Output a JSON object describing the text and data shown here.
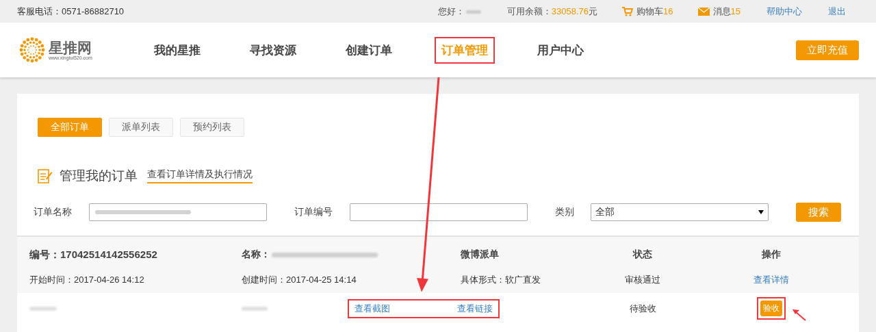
{
  "top_bar": {
    "hotline": "客服电话：0571-86882710",
    "greeting": "您好：",
    "balance_label": "可用余额：",
    "balance": "33058.76",
    "balance_unit": "元",
    "cart_label": "购物车",
    "cart_count": "16",
    "messages_label": "消息",
    "messages_count": "15",
    "links": [
      "帮助中心",
      "退出"
    ]
  },
  "logo": {
    "name": "星推网",
    "url": "www.xingtui520.com"
  },
  "nav": {
    "items": [
      {
        "label": "我的星推",
        "selected": false,
        "highlighted": false
      },
      {
        "label": "寻找资源",
        "selected": false,
        "highlighted": false
      },
      {
        "label": "创建订单",
        "selected": false,
        "highlighted": false
      },
      {
        "label": "订单管理",
        "selected": true,
        "highlighted": true
      },
      {
        "label": "用户中心",
        "selected": false,
        "highlighted": false
      }
    ],
    "recharge_button": "立即充值"
  },
  "tabs": [
    {
      "label": "全部订单",
      "selected": true
    },
    {
      "label": "派单列表",
      "selected": false
    },
    {
      "label": "预约列表",
      "selected": false
    }
  ],
  "section": {
    "title": "管理我的订单",
    "link": "查看订单详情及执行情况"
  },
  "filters": {
    "name_label": "订单名称",
    "number_label": "订单编号",
    "category_label": "类别",
    "category_value": "全部",
    "search_button": "搜索"
  },
  "order": {
    "number_label": "编号：",
    "number": "17042514142556252",
    "name_label": "名称：",
    "type": "微博派单",
    "status_header": "状态",
    "action_header": "操作",
    "start_time": "开始时间：2017-04-26 14:12",
    "created_time": "创建时间：2017-04-25 14:14",
    "form": "具体形式：软广直发",
    "status": "审核通过",
    "detail_link": "查看详情"
  },
  "dispatch_rows": [
    {
      "links": [
        "查看截图",
        "查看链接"
      ],
      "links_highlighted": true,
      "status": "待验收",
      "action": "验收",
      "action_highlighted": true
    }
  ]
}
